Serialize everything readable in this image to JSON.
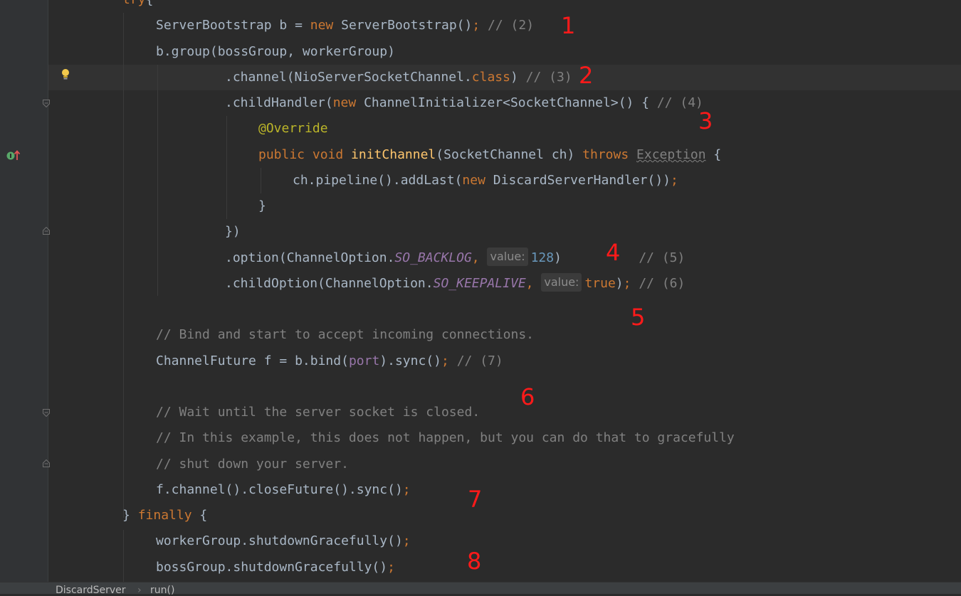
{
  "editor": {
    "lines": [
      {
        "id": "l00",
        "segments": [
          [
            "kw",
            "try"
          ],
          [
            "",
            "{"
          ]
        ]
      },
      {
        "id": "l01",
        "segments": [
          [
            "",
            "ServerBootstrap b = "
          ],
          [
            "kw",
            "new"
          ],
          [
            "",
            " ServerBootstrap()"
          ],
          [
            "kw",
            ";"
          ],
          [
            "cmt",
            " // (2)"
          ]
        ]
      },
      {
        "id": "l02",
        "segments": [
          [
            "",
            "b.group(bossGroup, workerGroup)"
          ]
        ]
      },
      {
        "id": "l03",
        "segments": [
          [
            "",
            ".channel(NioServerSocketChannel."
          ],
          [
            "kw",
            "class"
          ],
          [
            "",
            ") "
          ],
          [
            "cmt",
            "// (3)"
          ]
        ]
      },
      {
        "id": "l04",
        "segments": [
          [
            "",
            ".childHandler("
          ],
          [
            "kw",
            "new"
          ],
          [
            "",
            " ChannelInitializer<SocketChannel>() { "
          ],
          [
            "cmt",
            "// (4)"
          ]
        ]
      },
      {
        "id": "l05",
        "segments": [
          [
            "ann",
            "@Override"
          ]
        ]
      },
      {
        "id": "l06",
        "segments": [
          [
            "kw",
            "public void "
          ],
          [
            "fn",
            "initChannel"
          ],
          [
            "",
            "(SocketChannel ch) "
          ],
          [
            "kw",
            "throws "
          ],
          [
            "warn",
            "Exception"
          ],
          [
            "",
            " {"
          ]
        ]
      },
      {
        "id": "l07",
        "segments": [
          [
            "",
            "ch.pipeline().addLast("
          ],
          [
            "kw",
            "new"
          ],
          [
            "",
            " DiscardServerHandler())"
          ],
          [
            "kw",
            ";"
          ]
        ]
      },
      {
        "id": "l08",
        "segments": [
          [
            "",
            "}"
          ]
        ]
      },
      {
        "id": "l09",
        "segments": [
          [
            "",
            "})"
          ]
        ]
      },
      {
        "id": "l10",
        "segments": [
          [
            "",
            ".option(ChannelOption."
          ],
          [
            "const",
            "SO_BACKLOG"
          ],
          [
            "kw",
            ", "
          ],
          [
            "hint",
            "value:"
          ],
          [
            "num",
            "128"
          ],
          [
            "",
            ")          "
          ],
          [
            "cmt",
            "// (5)"
          ]
        ]
      },
      {
        "id": "l11",
        "segments": [
          [
            "",
            ".childOption(ChannelOption."
          ],
          [
            "const",
            "SO_KEEPALIVE"
          ],
          [
            "kw",
            ", "
          ],
          [
            "hint",
            "value:"
          ],
          [
            "kw",
            "true"
          ],
          [
            "",
            ")"
          ],
          [
            "kw",
            "; "
          ],
          [
            "cmt",
            "// (6)"
          ]
        ]
      },
      {
        "id": "l12",
        "segments": [
          [
            "cmt",
            "// Bind and start to accept incoming connections."
          ]
        ]
      },
      {
        "id": "l13",
        "segments": [
          [
            "",
            "ChannelFuture f = b.bind("
          ],
          [
            "field",
            "port"
          ],
          [
            "",
            ").sync()"
          ],
          [
            "kw",
            "; "
          ],
          [
            "cmt",
            "// (7)"
          ]
        ]
      },
      {
        "id": "l14",
        "segments": [
          [
            "cmt",
            "// Wait until the server socket is closed."
          ]
        ]
      },
      {
        "id": "l15",
        "segments": [
          [
            "cmt",
            "// In this example, this does not happen, but you can do that to gracefully"
          ]
        ]
      },
      {
        "id": "l16",
        "segments": [
          [
            "cmt",
            "// shut down your server."
          ]
        ]
      },
      {
        "id": "l17",
        "segments": [
          [
            "",
            "f.channel().closeFuture().sync()"
          ],
          [
            "kw",
            ";"
          ]
        ]
      },
      {
        "id": "l18",
        "segments": [
          [
            "",
            "} "
          ],
          [
            "kw",
            "finally "
          ],
          [
            "",
            "{"
          ]
        ]
      },
      {
        "id": "l19",
        "segments": [
          [
            "",
            "workerGroup.shutdownGracefully()"
          ],
          [
            "kw",
            ";"
          ]
        ]
      },
      {
        "id": "l20",
        "segments": [
          [
            "",
            "bossGroup.shutdownGracefully()"
          ],
          [
            "kw",
            ";"
          ]
        ]
      }
    ]
  },
  "annotations": [
    "1",
    "2",
    "3",
    "4",
    "5",
    "6",
    "7",
    "8"
  ],
  "breadcrumb": {
    "class_name": "DiscardServer",
    "separator": "›",
    "method_name": "run()"
  },
  "colors": {
    "background": "#2b2b2b",
    "keyword": "#cc7832",
    "comment": "#808080",
    "annotation": "#bbb529",
    "function": "#ffc66d",
    "constant": "#9876aa",
    "number": "#6897bb",
    "marker": "#ff1a1a"
  }
}
